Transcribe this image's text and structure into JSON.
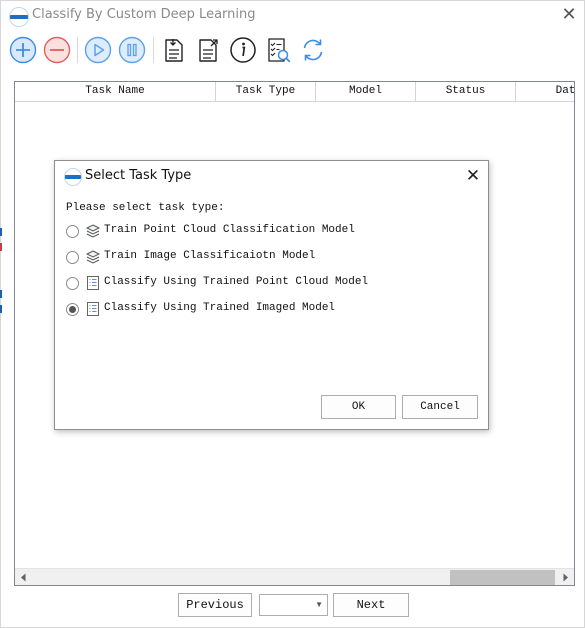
{
  "window": {
    "title": "Classify By Custom Deep Learning",
    "close_symbol": "✕"
  },
  "toolbar": {
    "buttons": [
      {
        "name": "add",
        "icon": "plus-circle-icon",
        "color": "#3a8ee6"
      },
      {
        "name": "remove",
        "icon": "minus-circle-icon",
        "color": "#e06060"
      },
      {
        "name": "start",
        "icon": "play-circle-icon",
        "color": "#5aa2ea"
      },
      {
        "name": "pause",
        "icon": "pause-circle-icon",
        "color": "#5aa2ea"
      },
      {
        "name": "import",
        "icon": "document-import-icon"
      },
      {
        "name": "export",
        "icon": "document-export-icon"
      },
      {
        "name": "info",
        "icon": "info-icon"
      },
      {
        "name": "view-log",
        "icon": "checklist-search-icon"
      },
      {
        "name": "refresh",
        "icon": "refresh-icon",
        "color": "#3a8ee6"
      }
    ]
  },
  "table": {
    "columns": [
      "Task Name",
      "Task Type",
      "Model",
      "Status",
      "Dat"
    ],
    "rows": []
  },
  "pager": {
    "previous_label": "Previous",
    "next_label": "Next",
    "page_select_value": ""
  },
  "dialog": {
    "title": "Select Task Type",
    "close_symbol": "✕",
    "prompt": "Please select task type:",
    "options": [
      {
        "label": "Train Point Cloud Classification Model",
        "icon": "layers-icon",
        "selected": false
      },
      {
        "label": "Train Image Classificaiotn Model",
        "icon": "layers-icon",
        "selected": false
      },
      {
        "label": "Classify Using Trained Point Cloud Model",
        "icon": "list-document-icon",
        "selected": false
      },
      {
        "label": "Classify Using Trained Imaged Model",
        "icon": "list-document-icon",
        "selected": true
      }
    ],
    "ok_label": "OK",
    "cancel_label": "Cancel"
  }
}
